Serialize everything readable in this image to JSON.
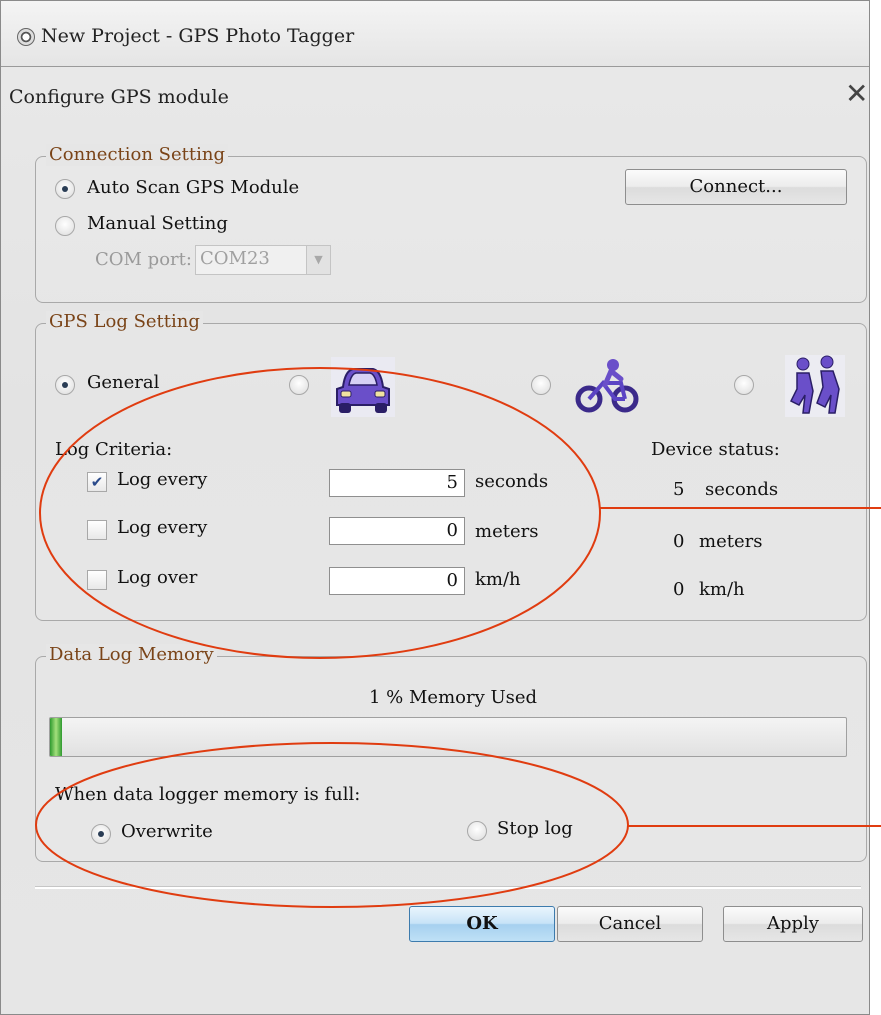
{
  "window": {
    "title": "New Project - GPS Photo Tagger"
  },
  "dialog": {
    "title": "Configure GPS module",
    "close_glyph": "✕"
  },
  "connection": {
    "legend": "Connection Setting",
    "auto_scan_label": "Auto Scan GPS Module",
    "auto_scan_checked": true,
    "manual_label": "Manual Setting",
    "com_port_label": "COM port:",
    "com_port_value": "COM23",
    "connect_button": "Connect..."
  },
  "log_setting": {
    "legend": "GPS Log Setting",
    "modes": [
      {
        "label": "General",
        "icon": "general",
        "checked": true
      },
      {
        "label": "",
        "icon": "car-icon",
        "checked": false
      },
      {
        "label": "",
        "icon": "bicycle-icon",
        "checked": false
      },
      {
        "label": "",
        "icon": "hiking-icon",
        "checked": false
      }
    ],
    "criteria_label": "Log Criteria:",
    "device_status_label": "Device status:",
    "rows": [
      {
        "label": "Log every",
        "checked": true,
        "value": "5",
        "unit": "seconds",
        "status_value": "5",
        "status_unit": "seconds"
      },
      {
        "label": "Log every",
        "checked": false,
        "value": "0",
        "unit": "meters",
        "status_value": "0",
        "status_unit": "meters"
      },
      {
        "label": "Log over",
        "checked": false,
        "value": "0",
        "unit": "km/h",
        "status_value": "0",
        "status_unit": "km/h"
      }
    ]
  },
  "memory": {
    "legend": "Data Log Memory",
    "used_text": "1 % Memory Used",
    "used_fraction": 0.01,
    "full_label": "When data logger memory is full:",
    "overwrite_label": "Overwrite",
    "overwrite_checked": true,
    "stop_label": "Stop log"
  },
  "buttons": {
    "ok": "OK",
    "cancel": "Cancel",
    "apply": "Apply"
  },
  "colors": {
    "legend_text": "#7a4418",
    "annotation": "#e03c10",
    "primary_button": "#a6d0ef",
    "progress_fill": "#2f9a2f"
  }
}
